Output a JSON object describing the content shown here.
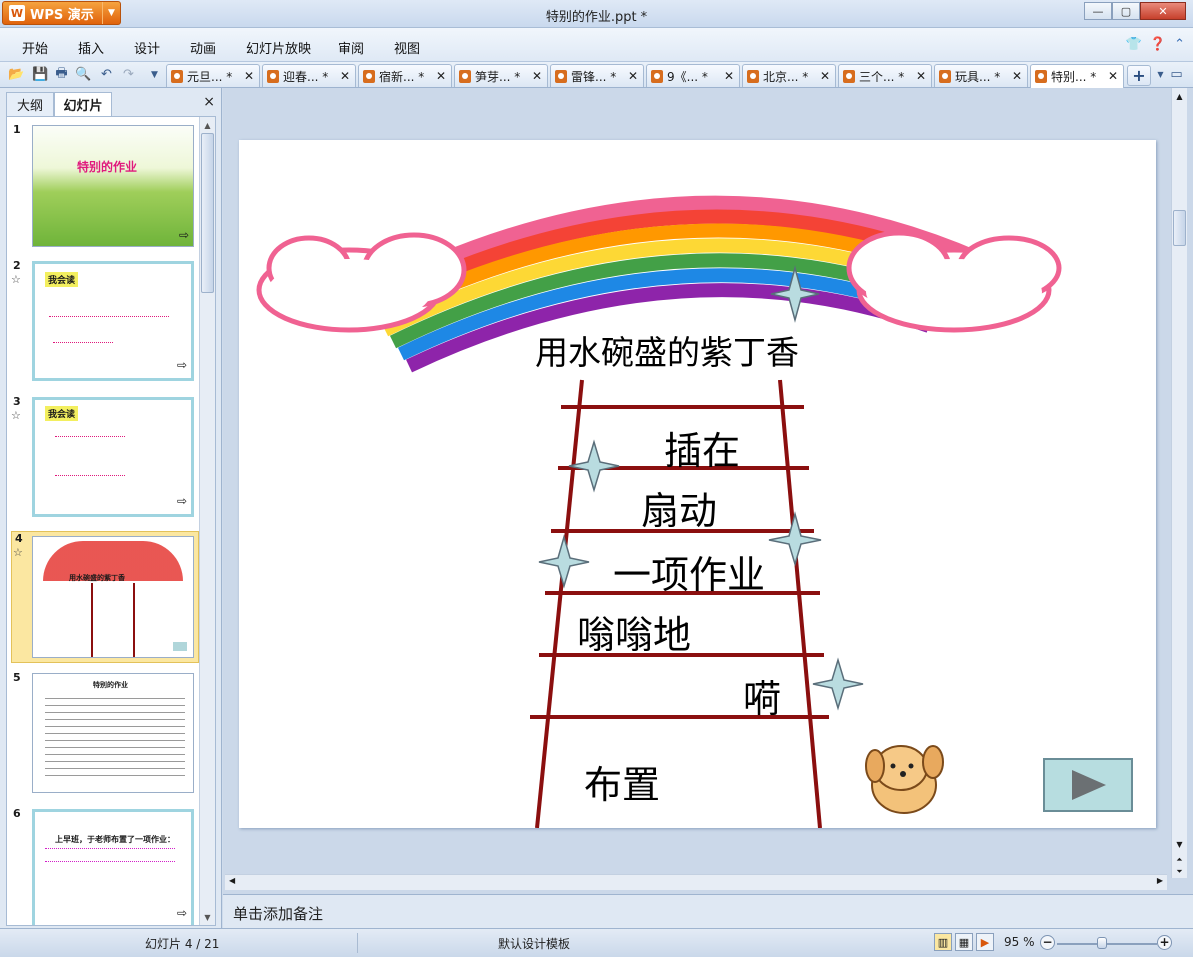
{
  "app": {
    "name": "WPS 演示",
    "logo": "W",
    "window_title": "特别的作业.ppt *"
  },
  "menu": [
    "开始",
    "插入",
    "设计",
    "动画",
    "幻灯片放映",
    "审阅",
    "视图"
  ],
  "tabs": [
    {
      "label": "元旦... *"
    },
    {
      "label": "迎春... *"
    },
    {
      "label": "宿新... *"
    },
    {
      "label": "笋芽... *"
    },
    {
      "label": "雷锋... *"
    },
    {
      "label": "9《... *"
    },
    {
      "label": "北京... *"
    },
    {
      "label": "三个... *"
    },
    {
      "label": "玩具... *"
    },
    {
      "label": "特别... *"
    }
  ],
  "left_panel": {
    "tab_outline": "大纲",
    "tab_slides": "幻灯片",
    "close": "×"
  },
  "thumbnails": [
    {
      "num": "1",
      "title": "特别的作业"
    },
    {
      "num": "2",
      "heading": "我会读"
    },
    {
      "num": "3",
      "heading": "我会读"
    },
    {
      "num": "4",
      "title": "用水碗盛的紫丁香"
    },
    {
      "num": "5",
      "title": "特别的作业"
    },
    {
      "num": "6",
      "text": "上早班，于老师布置了一项作业："
    }
  ],
  "slide": {
    "title": "用水碗盛的紫丁香",
    "words": [
      "插在",
      "扇动",
      "一项作业",
      "嗡嗡地",
      "嗬",
      "布置"
    ]
  },
  "notes_placeholder": "单击添加备注",
  "status": {
    "slide_pos": "幻灯片 4 / 21",
    "template": "默认设计模板",
    "zoom": "95 %"
  },
  "colors": {
    "accent_orange": "#e0620c",
    "ladder": "#8b0f0f",
    "star": "#b9dce0"
  }
}
